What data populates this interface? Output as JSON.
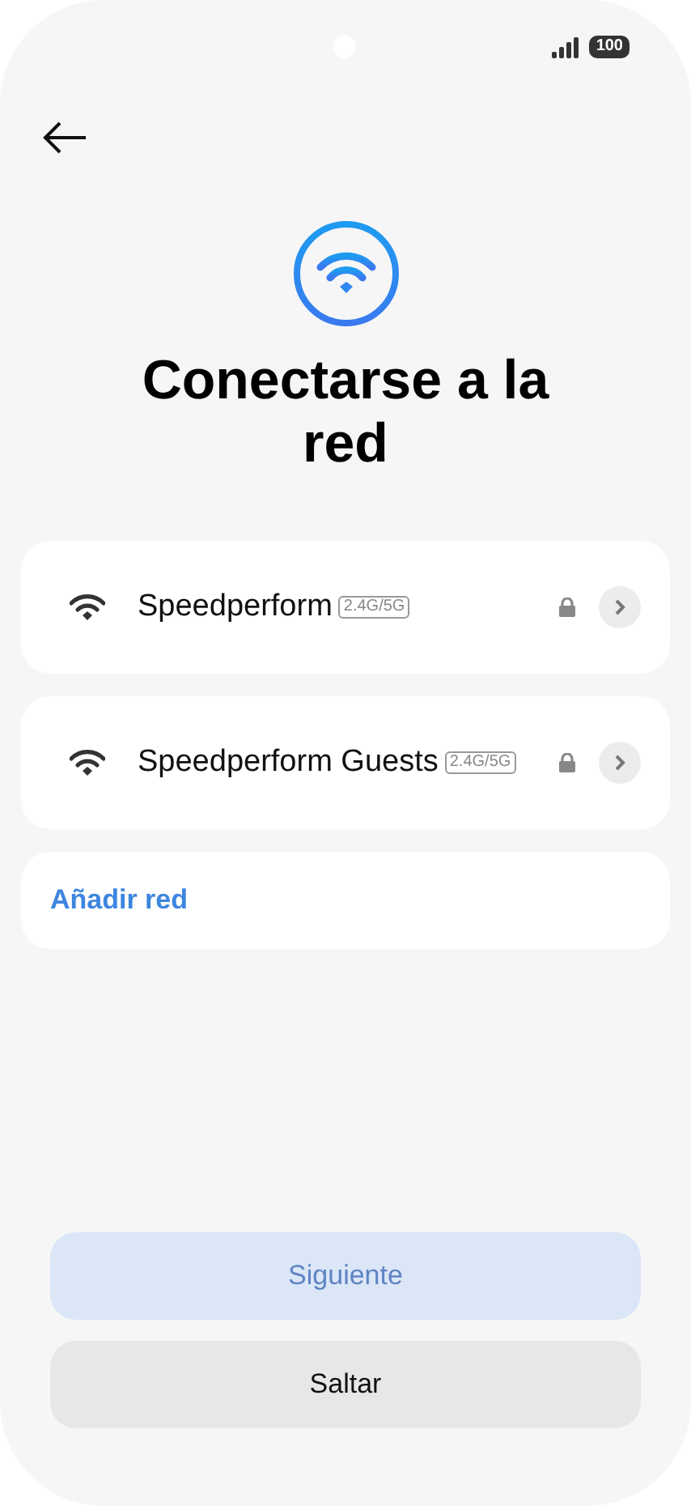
{
  "status_bar": {
    "battery": "100"
  },
  "title": "Conectarse a la red",
  "networks": [
    {
      "name": "Speedperform",
      "band": "2.4G/5G",
      "secured": true
    },
    {
      "name": "Speedperform Guests",
      "band": "2.4G/5G",
      "secured": true
    }
  ],
  "add_network": "Añadir red",
  "buttons": [
    {
      "label": "Siguiente",
      "kind": "primary",
      "disabled": true
    },
    {
      "label": "Saltar",
      "kind": "secondary",
      "disabled": false
    }
  ]
}
